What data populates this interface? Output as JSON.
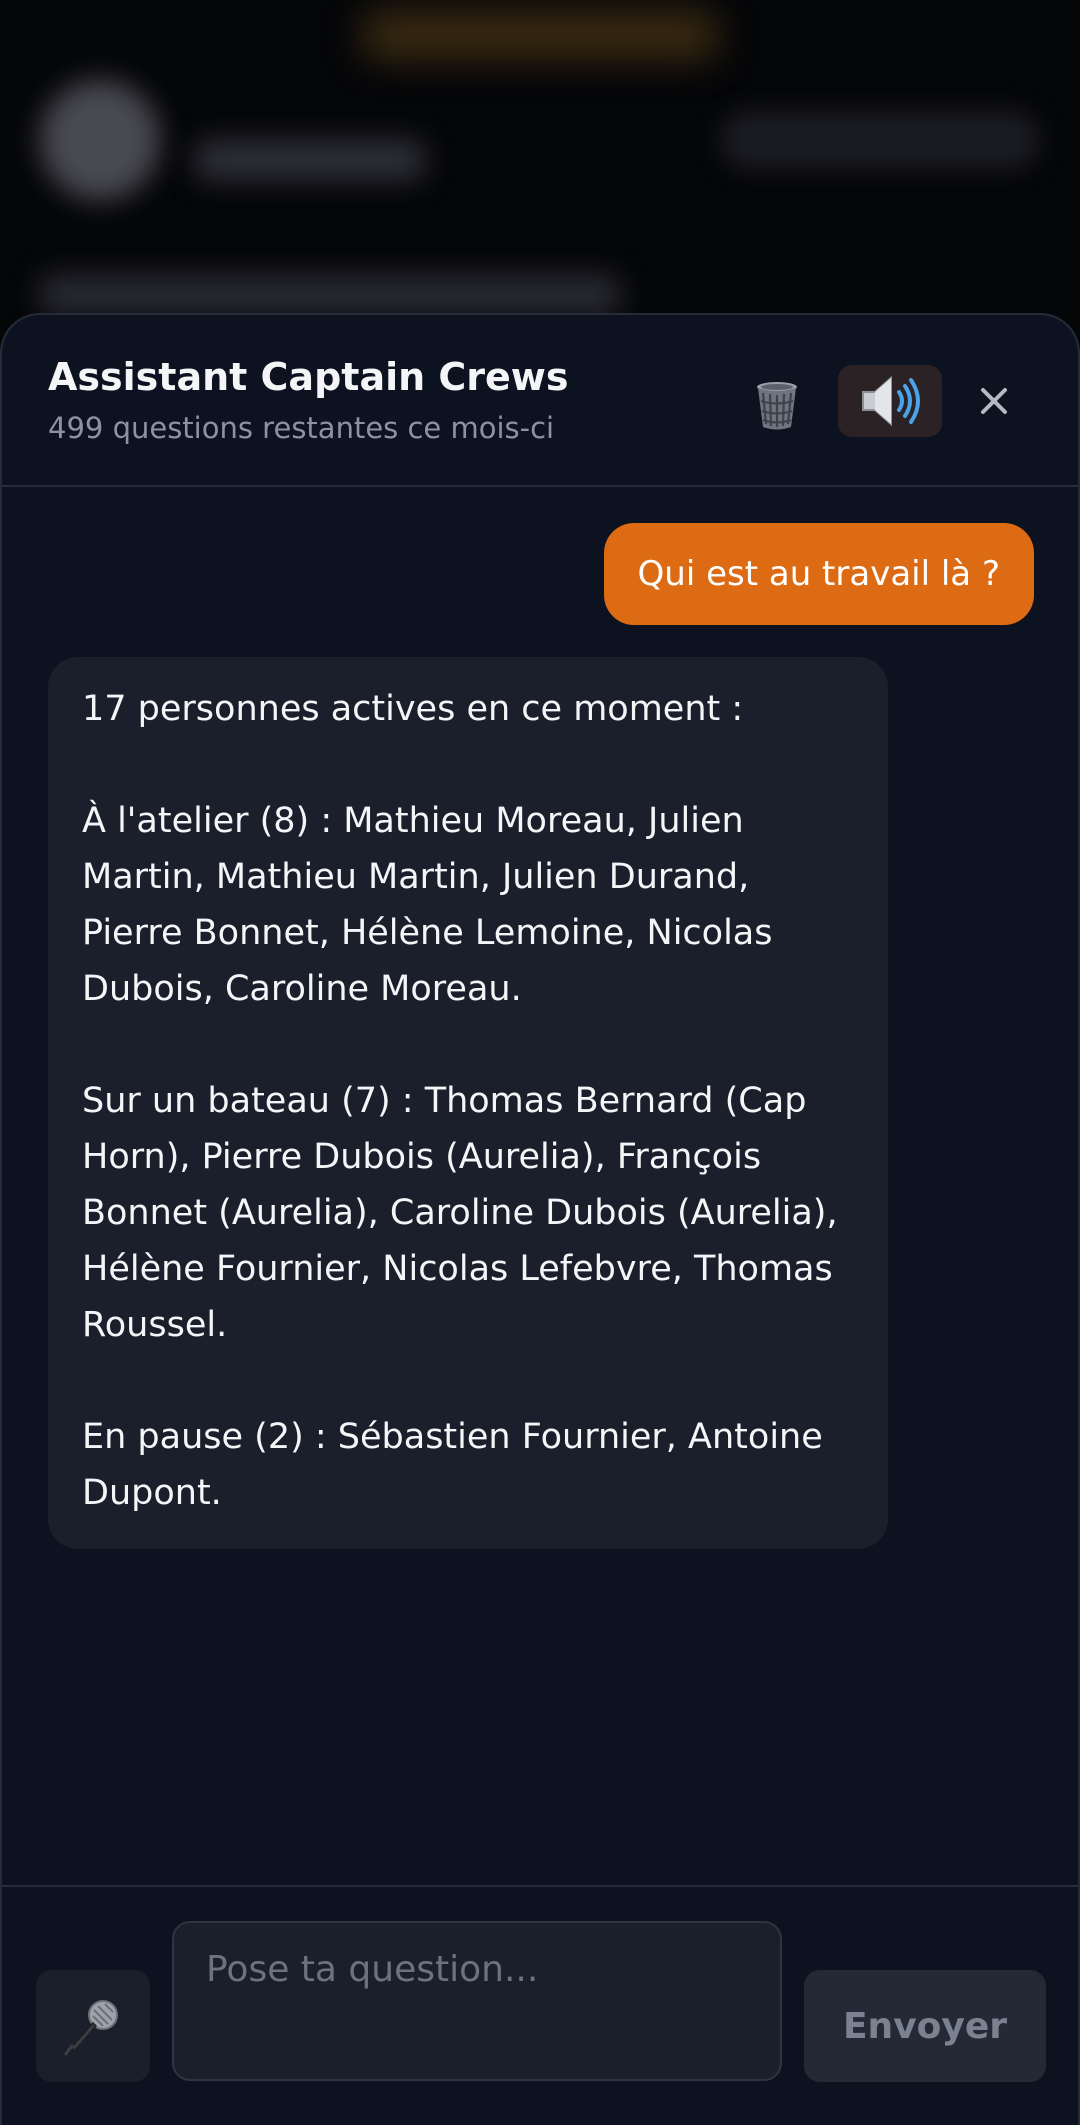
{
  "header": {
    "title": "Assistant Captain Crews",
    "subtitle": "499 questions restantes ce mois-ci",
    "icons": {
      "clear": "trash-icon",
      "audio": "speaker-icon",
      "close": "close-icon"
    }
  },
  "messages": {
    "user": {
      "text": "Qui est au travail là ?"
    },
    "assistant": {
      "paragraphs": [
        "17 personnes actives en ce moment :",
        "À l'atelier (8) : Mathieu Moreau, Julien Martin, Mathieu Martin, Julien Durand, Pierre Bonnet, Hélène Lemoine, Nicolas Dubois, Caroline Moreau.",
        "Sur un bateau (7) : Thomas Bernard (Cap Horn), Pierre Dubois (Aurelia), François Bonnet (Aurelia), Caroline Dubois (Aurelia), Hélène Fournier, Nicolas Lefebvre, Thomas Roussel.",
        "En pause (2) : Sébastien Fournier, Antoine Dupont."
      ]
    }
  },
  "composer": {
    "placeholder": "Pose ta question...",
    "value": "",
    "send_label": "Envoyer",
    "mic_icon": "microphone-icon"
  },
  "colors": {
    "accent": "#dd6b14",
    "sheet_background": "#0d1220",
    "bubble_background": "#1b1f2b"
  }
}
